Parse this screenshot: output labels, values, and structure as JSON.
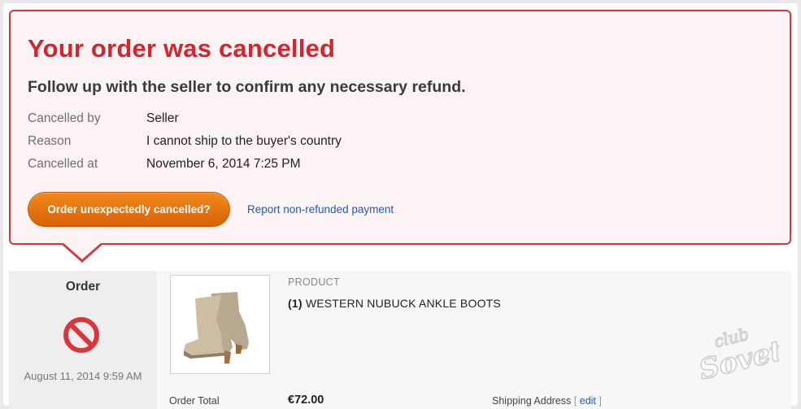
{
  "alert": {
    "title": "Your order was cancelled",
    "subtitle": "Follow up with the seller to confirm any necessary refund.",
    "details": [
      {
        "label": "Cancelled by",
        "value": "Seller"
      },
      {
        "label": "Reason",
        "value": "I cannot ship to the buyer's country"
      },
      {
        "label": "Cancelled at",
        "value": "November 6, 2014 7:25 PM"
      }
    ],
    "button_label": "Order unexpectedly cancelled?",
    "report_link": "Report non-refunded payment",
    "colors": {
      "border": "#d0393e",
      "title": "#d0262f",
      "button": "#e47311",
      "link": "#1f5bb5"
    }
  },
  "order": {
    "title": "Order",
    "status_icon": "cancelled-icon",
    "date": "August 11, 2014 9:59 AM"
  },
  "product": {
    "header": "PRODUCT",
    "quantity": "(1)",
    "name": "WESTERN NUBUCK ANKLE BOOTS",
    "image_icon": "ankle-boots-image"
  },
  "totals": {
    "order_total_label": "Order Total",
    "order_total_value": "€72.00",
    "shipping_label": "Shipping Address",
    "edit_open": "[",
    "edit_link": "edit",
    "edit_close": "]"
  },
  "watermark": {
    "line1": "club",
    "line2": "Sovet"
  }
}
